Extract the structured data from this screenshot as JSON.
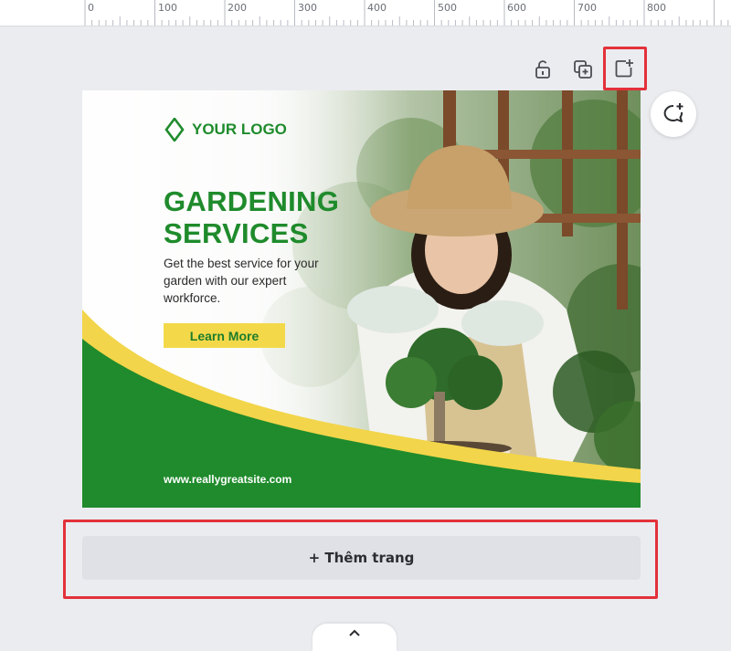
{
  "ruler": {
    "labels": [
      "0",
      "100",
      "200",
      "300",
      "400",
      "500",
      "600",
      "700",
      "800"
    ]
  },
  "toolbar": {
    "icons": [
      "lock-icon",
      "duplicate-page-icon",
      "add-page-icon"
    ],
    "comment_icon": "add-comment-icon"
  },
  "design": {
    "logo_text": "YOUR LOGO",
    "headline_line1": "GARDENING",
    "headline_line2": "SERVICES",
    "subtext": "Get the best service for your garden with our expert workforce.",
    "button_label": "Learn More",
    "website": "www.reallygreatsite.com",
    "colors": {
      "green": "#1f8b2c",
      "yellow": "#f3d94a"
    }
  },
  "add_page": {
    "label": "+ Thêm trang"
  },
  "bottom": {
    "chevron_icon": "chevron-up-icon"
  }
}
